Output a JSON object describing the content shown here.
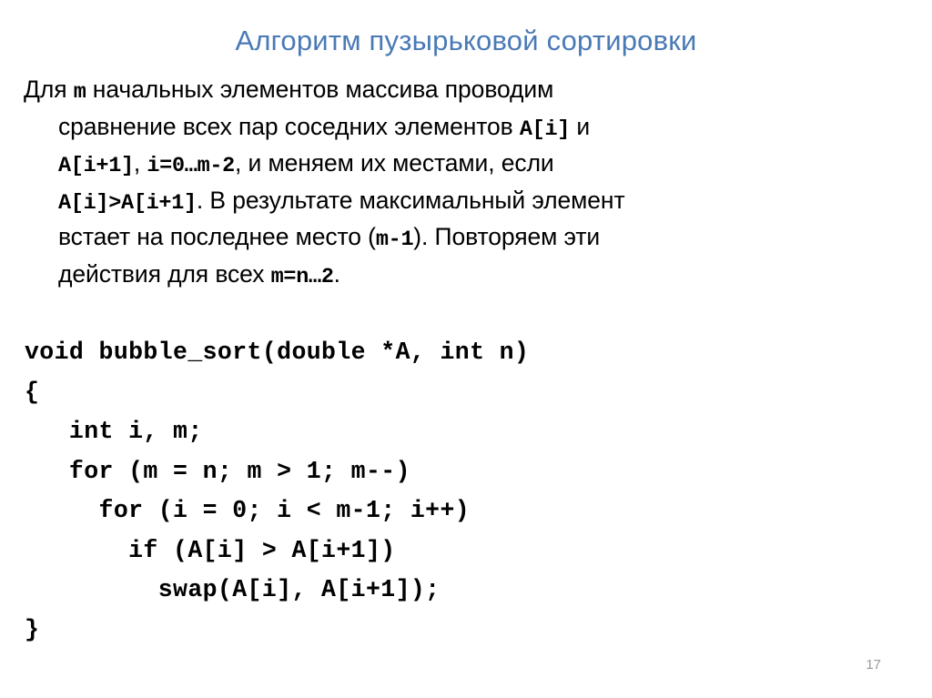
{
  "slide": {
    "title": "Алгоритм пузырьковой сортировки",
    "page_number": "17",
    "title_color": "#4a7ab5",
    "page_number_color": "#9a9a9a",
    "background_color": "#ffffff",
    "text_color": "#000000"
  },
  "paragraph": {
    "lines": [
      {
        "indent": false,
        "parts": [
          {
            "text": "Для ",
            "mono": false
          },
          {
            "text": "m",
            "mono": true
          },
          {
            "text": " начальных элементов массива проводим",
            "mono": false
          }
        ]
      },
      {
        "indent": true,
        "parts": [
          {
            "text": "сравнение всех пар соседних элементов ",
            "mono": false
          },
          {
            "text": "A[i]",
            "mono": true
          },
          {
            "text": " и",
            "mono": false
          }
        ]
      },
      {
        "indent": true,
        "parts": [
          {
            "text": "A[i+1]",
            "mono": true
          },
          {
            "text": ", ",
            "mono": false
          },
          {
            "text": "i=0…m-2",
            "mono": true
          },
          {
            "text": ", и меняем их местами, если",
            "mono": false
          }
        ]
      },
      {
        "indent": true,
        "parts": [
          {
            "text": "A[i]>A[i+1]",
            "mono": true
          },
          {
            "text": ". В результате максимальный элемент",
            "mono": false
          }
        ]
      },
      {
        "indent": true,
        "parts": [
          {
            "text": "встает на последнее место (",
            "mono": false
          },
          {
            "text": "m-1",
            "mono": true
          },
          {
            "text": "). Повторяем эти",
            "mono": false
          }
        ]
      },
      {
        "indent": true,
        "parts": [
          {
            "text": "действия для всех  ",
            "mono": false
          },
          {
            "text": "m=n…2",
            "mono": true
          },
          {
            "text": ".",
            "mono": false
          }
        ]
      }
    ]
  },
  "code": {
    "language": "c",
    "lines": [
      "void bubble_sort(double *A, int n)",
      "{",
      "   int i, m;",
      "   for (m = n; m > 1; m--)",
      "     for (i = 0; i < m-1; i++)",
      "       if (A[i] > A[i+1])",
      "         swap(A[i], A[i+1]);",
      "}"
    ]
  }
}
